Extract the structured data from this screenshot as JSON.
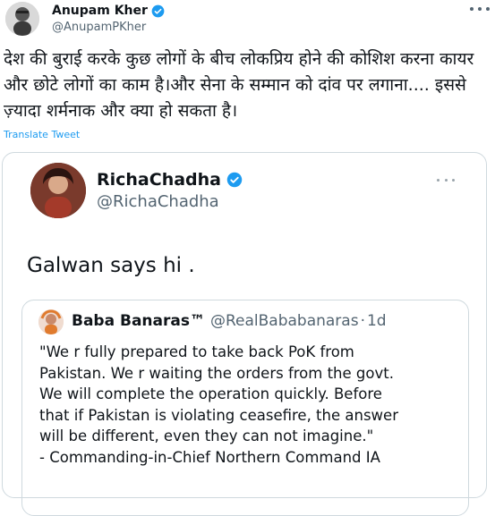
{
  "tweet": {
    "author_name": "Anupam Kher",
    "author_handle": "@AnupamPKher",
    "text": "देश की बुराई करके कुछ लोगों के बीच लोकप्रिय होने की कोशिश करना कायर और छोटे लोगों का काम है।और सेना के सम्मान को दांव पर लगाना.... इससे ज़्यादा शर्मनाक और क्या हो सकता है।",
    "translate_label": "Translate Tweet"
  },
  "quoted": {
    "author_name": "RichaChadha",
    "author_handle": "@RichaChadha",
    "text": "Galwan says hi ."
  },
  "inner_quoted": {
    "author_name": "Baba Banaras™",
    "author_handle": "@RealBababanaras",
    "separator": "·",
    "time": "1d",
    "lines": [
      "\"We r fully prepared to take back PoK from",
      "Pakistan. We r waiting the orders from the govt.",
      "We will complete the operation quickly. Before",
      "that if Pakistan is violating ceasefire, the answer",
      "will be different, even they can not imagine.\"",
      "- Commanding-in-Chief Northern Command IA"
    ]
  },
  "colors": {
    "verified_blue": "#1d9bf0",
    "link_blue": "#1d9bf0",
    "secondary_text": "#536471",
    "border": "#cfd9de"
  },
  "icons": [
    "verified-badge-icon",
    "more-options-icon"
  ]
}
